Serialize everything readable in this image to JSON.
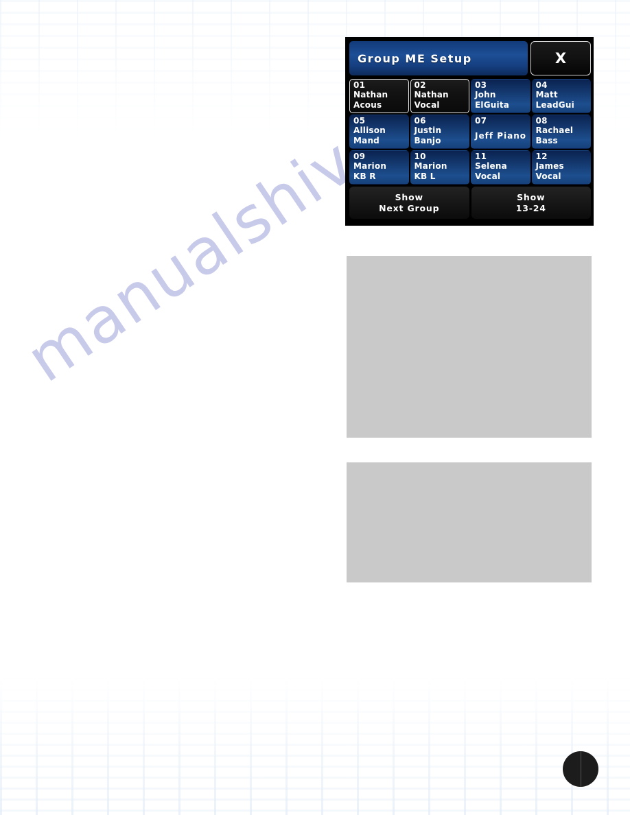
{
  "page": {
    "background_color": "#ffffff",
    "watermark_text": "manualshive.com",
    "watermark_color": "#b3b6e2"
  },
  "panel": {
    "title": "Group ME Setup",
    "close_label": "X",
    "background_color": "#000000",
    "title_accent_color": "#1d4f96",
    "cell_color": "#1d4e8e",
    "selected_cell_color": "#0a0a0a"
  },
  "channels": [
    {
      "number": "01",
      "line1": "Nathan",
      "line2": "Acous",
      "selected": true,
      "single": false
    },
    {
      "number": "02",
      "line1": "Nathan",
      "line2": "Vocal",
      "selected": true,
      "single": false
    },
    {
      "number": "03",
      "line1": "John",
      "line2": "ElGuita",
      "selected": false,
      "single": false
    },
    {
      "number": "04",
      "line1": "Matt",
      "line2": "LeadGui",
      "selected": false,
      "single": false
    },
    {
      "number": "05",
      "line1": "Allison",
      "line2": "Mand",
      "selected": false,
      "single": false
    },
    {
      "number": "06",
      "line1": "Justin",
      "line2": "Banjo",
      "selected": false,
      "single": false
    },
    {
      "number": "07",
      "line1": "Jeff Piano",
      "line2": "",
      "selected": false,
      "single": true
    },
    {
      "number": "08",
      "line1": "Rachael",
      "line2": "Bass",
      "selected": false,
      "single": false
    },
    {
      "number": "09",
      "line1": "Marion",
      "line2": "KB R",
      "selected": false,
      "single": false
    },
    {
      "number": "10",
      "line1": "Marion",
      "line2": "KB L",
      "selected": false,
      "single": false
    },
    {
      "number": "11",
      "line1": "Selena",
      "line2": "Vocal",
      "selected": false,
      "single": false
    },
    {
      "number": "12",
      "line1": "James",
      "line2": "Vocal",
      "selected": false,
      "single": false
    }
  ],
  "actions": [
    {
      "line1": "Show",
      "line2": "Next Group"
    },
    {
      "line1": "Show",
      "line2": "13-24"
    }
  ]
}
